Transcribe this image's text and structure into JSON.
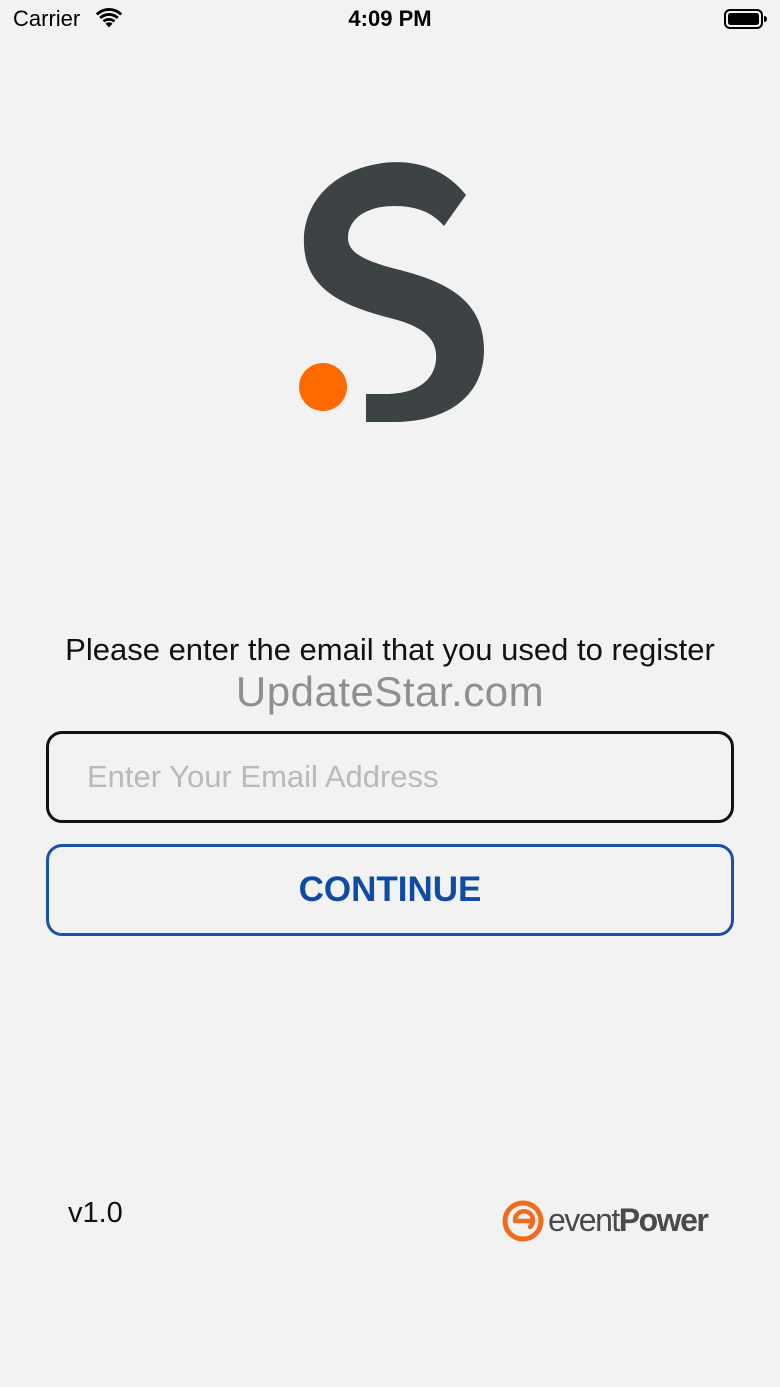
{
  "status_bar": {
    "carrier": "Carrier",
    "time": "4:09 PM",
    "icons": [
      "wifi-icon",
      "battery-icon"
    ]
  },
  "logo": {
    "icon": "s-logo-icon",
    "letter_color": "#3d4245",
    "dot_color": "#ff6a00"
  },
  "login": {
    "prompt": "Please enter the email that you used to register",
    "email_placeholder": "Enter Your Email Address",
    "email_value": "",
    "continue_label": "CONTINUE"
  },
  "watermark": "UpdateStar.com",
  "footer": {
    "version": "v1.0",
    "brand": {
      "icon": "eventpower-logo-icon",
      "light_text": "event",
      "bold_text": "Power",
      "accent_color": "#f26a1b"
    }
  },
  "colors": {
    "background": "#f2f2f2",
    "button_border": "#1a52a8",
    "button_text": "#0f4aa3",
    "input_border": "#111111"
  }
}
